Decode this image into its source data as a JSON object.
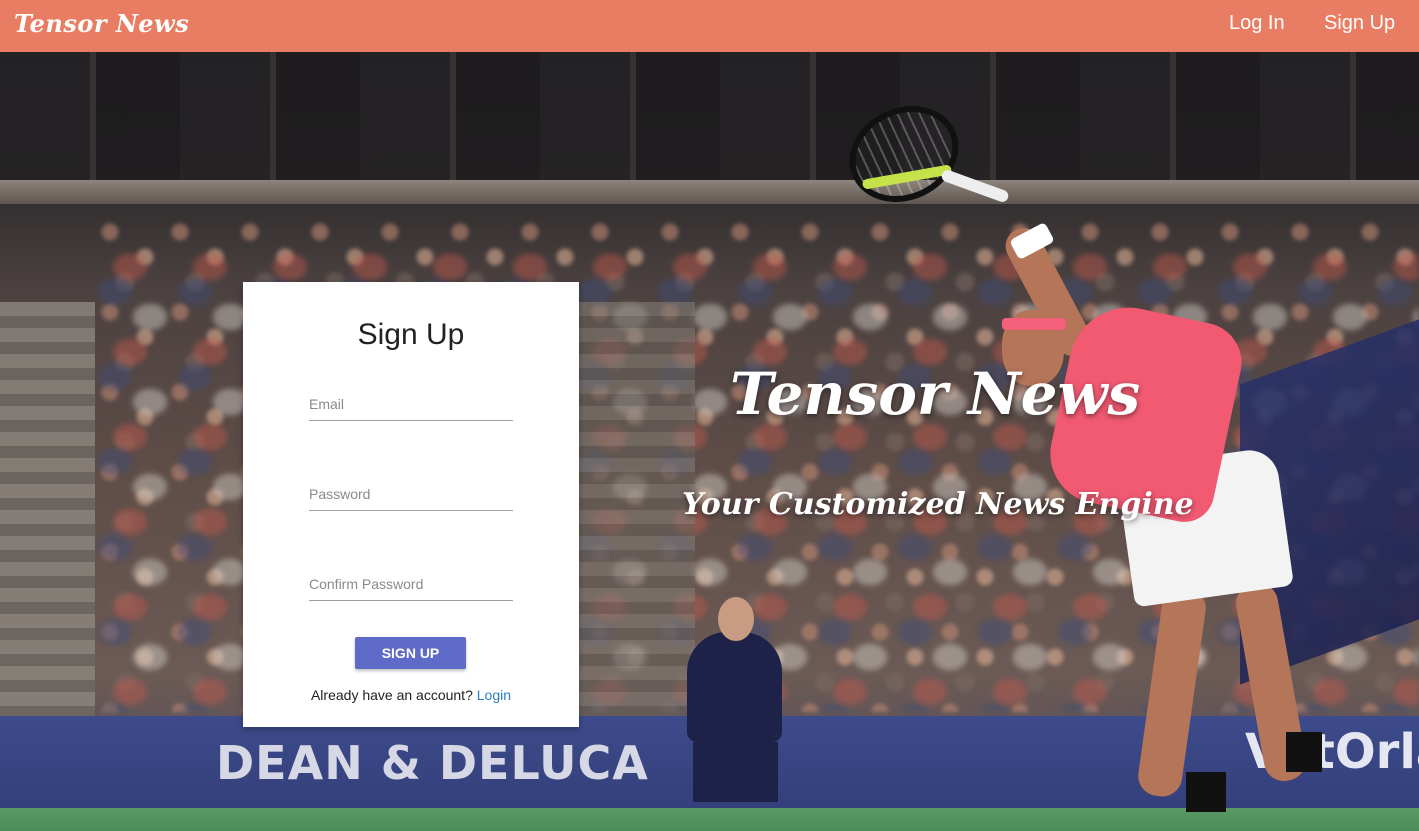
{
  "navbar": {
    "brand": "Tensor News",
    "login_label": "Log In",
    "signup_label": "Sign Up"
  },
  "hero": {
    "title": "Tensor News",
    "subtitle": "Your Customized News Engine"
  },
  "background": {
    "banner_left_text": "DEAN & DELUCA",
    "banner_right_text": "VatOrla"
  },
  "signup_card": {
    "title": "Sign Up",
    "email_placeholder": "Email",
    "password_placeholder": "Password",
    "confirm_placeholder": "Confirm Password",
    "submit_label": "SIGN UP",
    "already_text": "Already have an account?",
    "login_link": "Login"
  },
  "colors": {
    "navbar": "#e97d63",
    "button": "#5f6bc8",
    "link": "#2b7bc2"
  }
}
